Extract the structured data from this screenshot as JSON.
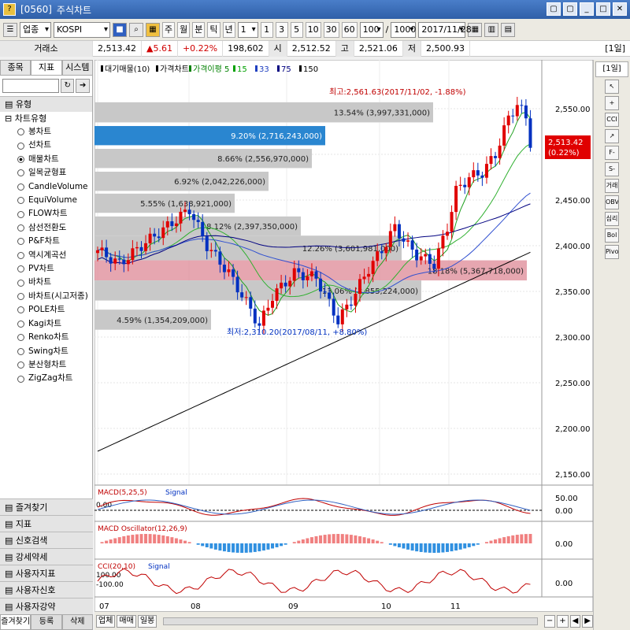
{
  "window": {
    "code": "[0560]",
    "title": "주식차트",
    "buttons": [
      "▢",
      "▢",
      "_",
      "□",
      "✕"
    ]
  },
  "toolbar": {
    "market_select": "업종",
    "symbol": "KOSPI",
    "search_label": "",
    "periods": [
      "주",
      "월",
      "분",
      "틱",
      "년"
    ],
    "period_input": "1",
    "intervals": [
      "1",
      "3",
      "5",
      "10",
      "30",
      "60"
    ],
    "count_value": "100",
    "count_total": "1000",
    "date_value": "2017/11/28"
  },
  "quote": {
    "market": "거래소",
    "price": "2,513.42",
    "change": "▲5.61",
    "change_pct": "+0.22%",
    "volume": "198,602",
    "open_label": "시",
    "open": "2,512.52",
    "high_label": "고",
    "high": "2,521.06",
    "low_label": "저",
    "low": "2,500.93",
    "period_badge": "[1일]"
  },
  "left": {
    "tabs": [
      "종목",
      "지표",
      "시스템"
    ],
    "group_title": "유형",
    "tree_title": "차트유형",
    "items": [
      "봉차트",
      "선차트",
      "매물차트",
      "일목균형표",
      "CandleVolume",
      "EquiVolume",
      "FLOW차트",
      "삼선전환도",
      "P&F차트",
      "역시계곡선",
      "PV차트",
      "바차트",
      "바차트(시고저종)",
      "POLE차트",
      "Kagi차트",
      "Renko차트",
      "Swing차트",
      "분산형차트",
      "ZigZag차트"
    ],
    "selected_index": 2,
    "bottom_groups": [
      "즐겨찾기",
      "지표",
      "신호검색",
      "강세약세",
      "사용자지표",
      "사용자신호",
      "사용자강약"
    ],
    "bottom_tabs": [
      "즐겨찾기",
      "등록",
      "삭제"
    ]
  },
  "chart": {
    "legend": [
      "대기매물(10)",
      "가격차트",
      "가격이평 5",
      "15",
      "33",
      "75",
      "150"
    ],
    "legend_colors": [
      "#000000",
      "#000000",
      "#008000",
      "#00a000",
      "#2040c0",
      "#000080",
      "#000000"
    ],
    "annotation_high": "최고:2,561.63(2017/11/02, -1.88%)",
    "annotation_low": "최저:2,310.20(2017/08/11, +8.80%)",
    "last_price_label": "2,513.42",
    "last_price_pct": "(0.22%)",
    "y_ticks": [
      "2,550.00",
      "2,500.00",
      "2,450.00",
      "2,400.00",
      "2,350.00",
      "2,300.00",
      "2,250.00",
      "2,200.00",
      "2,150.00"
    ],
    "x_ticks": [
      "07",
      "08",
      "09",
      "10",
      "11"
    ],
    "volume_profile": [
      {
        "label": "13.54% (3,997,331,000)",
        "highlight": "none"
      },
      {
        "label": "9.20% (2,716,243,000)",
        "highlight": "blue"
      },
      {
        "label": "8.66% (2,556,970,000)",
        "highlight": "none"
      },
      {
        "label": "6.92% (2,042,226,000)",
        "highlight": "none"
      },
      {
        "label": "5.55% (1,638,921,000)",
        "highlight": "none"
      },
      {
        "label": "8.12% (2,397,350,000)",
        "highlight": "none"
      },
      {
        "label": "12.26% (3,601,981,000)",
        "highlight": "none"
      },
      {
        "label": "18.18% (5,367,718,000)",
        "highlight": "red"
      },
      {
        "label": "13.06% (3,855,224,000)",
        "highlight": "none"
      },
      {
        "label": "4.59% (1,354,209,000)",
        "highlight": "none"
      }
    ],
    "macd": {
      "title": "MACD(5,25,5)",
      "signal": "Signal",
      "ticks": [
        "50.00",
        "0.00"
      ],
      "left_tick": "0.00"
    },
    "osc": {
      "title": "MACD Oscillator(12,26,9)",
      "ticks": [
        "0.00"
      ]
    },
    "cci": {
      "title": "CCI(20,10)",
      "signal": "Signal",
      "ticks": [
        "0.00"
      ],
      "left_ticks": [
        "100.00",
        "-100.00"
      ]
    }
  },
  "right_toolbar": [
    "↖",
    "+",
    "CCI",
    "↗",
    "F-Stoc",
    "S-Stoc",
    "거래량",
    "OBV",
    "심리도",
    "Bol Band",
    "Pivot"
  ],
  "bottom_bar": [
    "업체",
    "매매",
    "일봉",
    "",
    ""
  ]
}
